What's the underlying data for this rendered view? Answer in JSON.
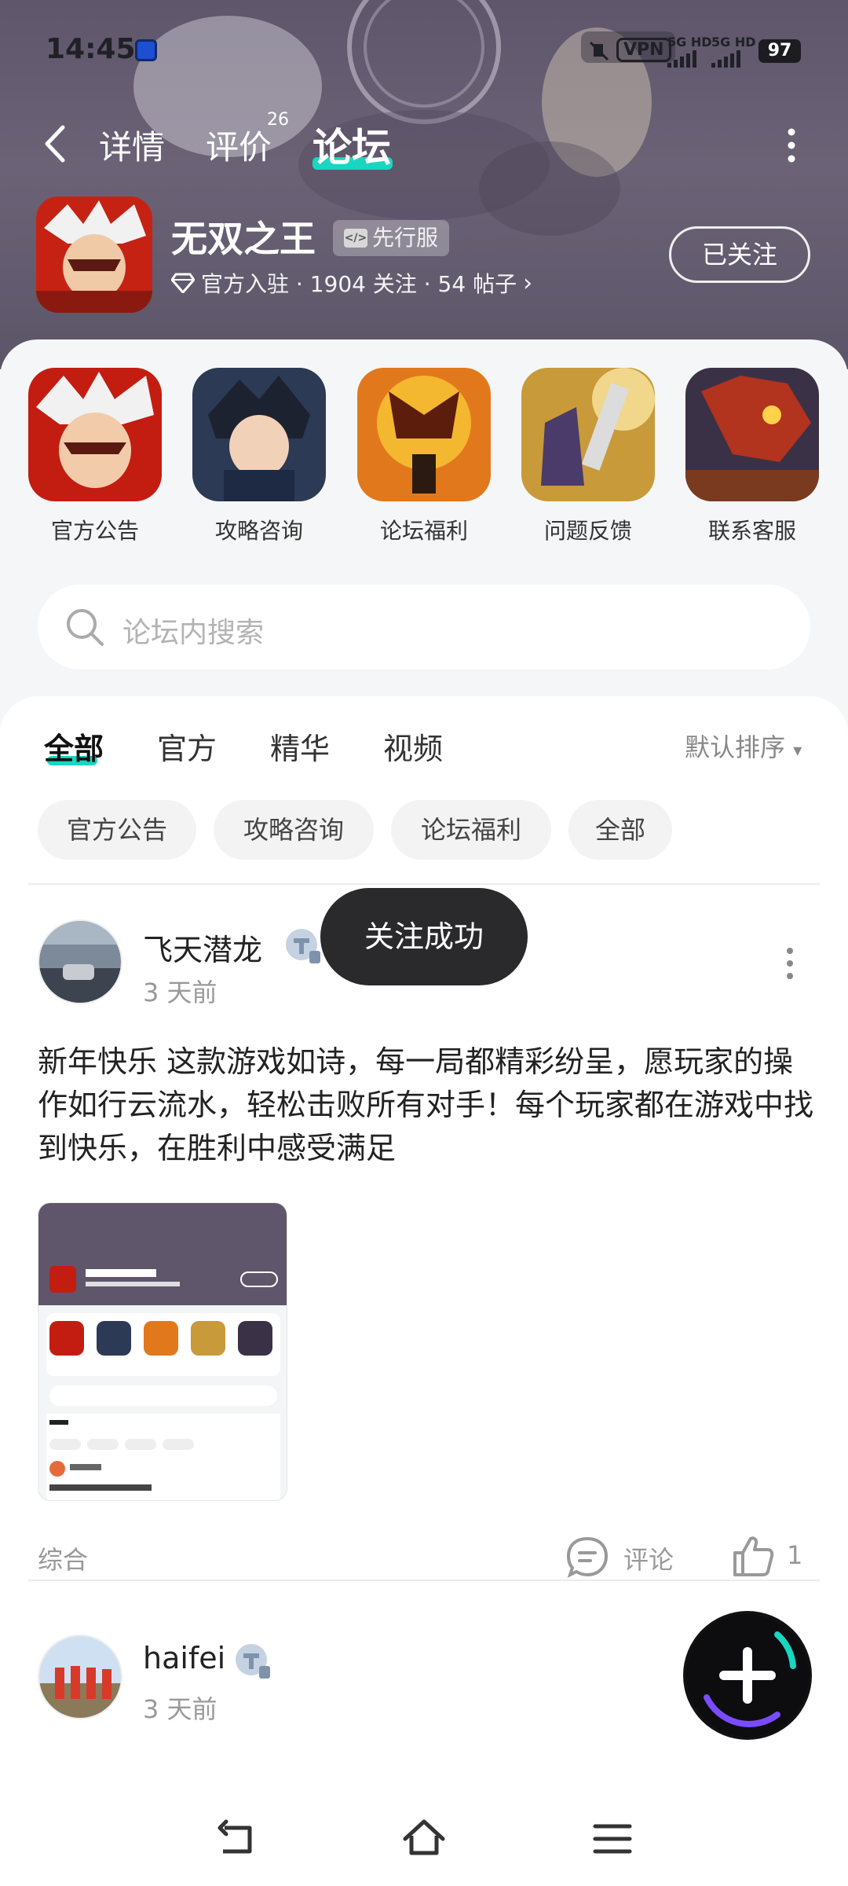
{
  "status_bar": {
    "time": "14:45",
    "vpn": "VPN",
    "sim1": "5G HD",
    "sim2": "5G HD",
    "battery": "97"
  },
  "nav": {
    "tabs": [
      "详情",
      "评价",
      "论坛"
    ],
    "active_tab": "论坛",
    "review_badge": "26"
  },
  "game": {
    "title": "无双之王",
    "badge": "先行服",
    "meta": "官方入驻 · 1904 关注 · 54 帖子",
    "follow_label": "已关注"
  },
  "quick_links": [
    {
      "label": "官方公告"
    },
    {
      "label": "攻略咨询"
    },
    {
      "label": "论坛福利"
    },
    {
      "label": "问题反馈"
    },
    {
      "label": "联系客服"
    }
  ],
  "search": {
    "placeholder": "论坛内搜索"
  },
  "feed_tabs": [
    "全部",
    "官方",
    "精华",
    "视频"
  ],
  "sort_label": "默认排序",
  "chips": [
    "官方公告",
    "攻略咨询",
    "论坛福利",
    "全部"
  ],
  "posts": [
    {
      "author": "飞天潜龙",
      "time": "3 天前",
      "text": "新年快乐  这款游戏如诗，每一局都精彩纷呈，愿玩家的操作如行云流水，轻松击败所有对手！每个玩家都在游戏中找到快乐，在胜利中感受满足",
      "category": "综合",
      "comment_label": "评论",
      "likes": "1"
    },
    {
      "author": "haifei",
      "time": "3 天前"
    }
  ],
  "toast": "关注成功",
  "colors": {
    "accent": "#19d6c1",
    "hero_bg": "#5f566b"
  }
}
